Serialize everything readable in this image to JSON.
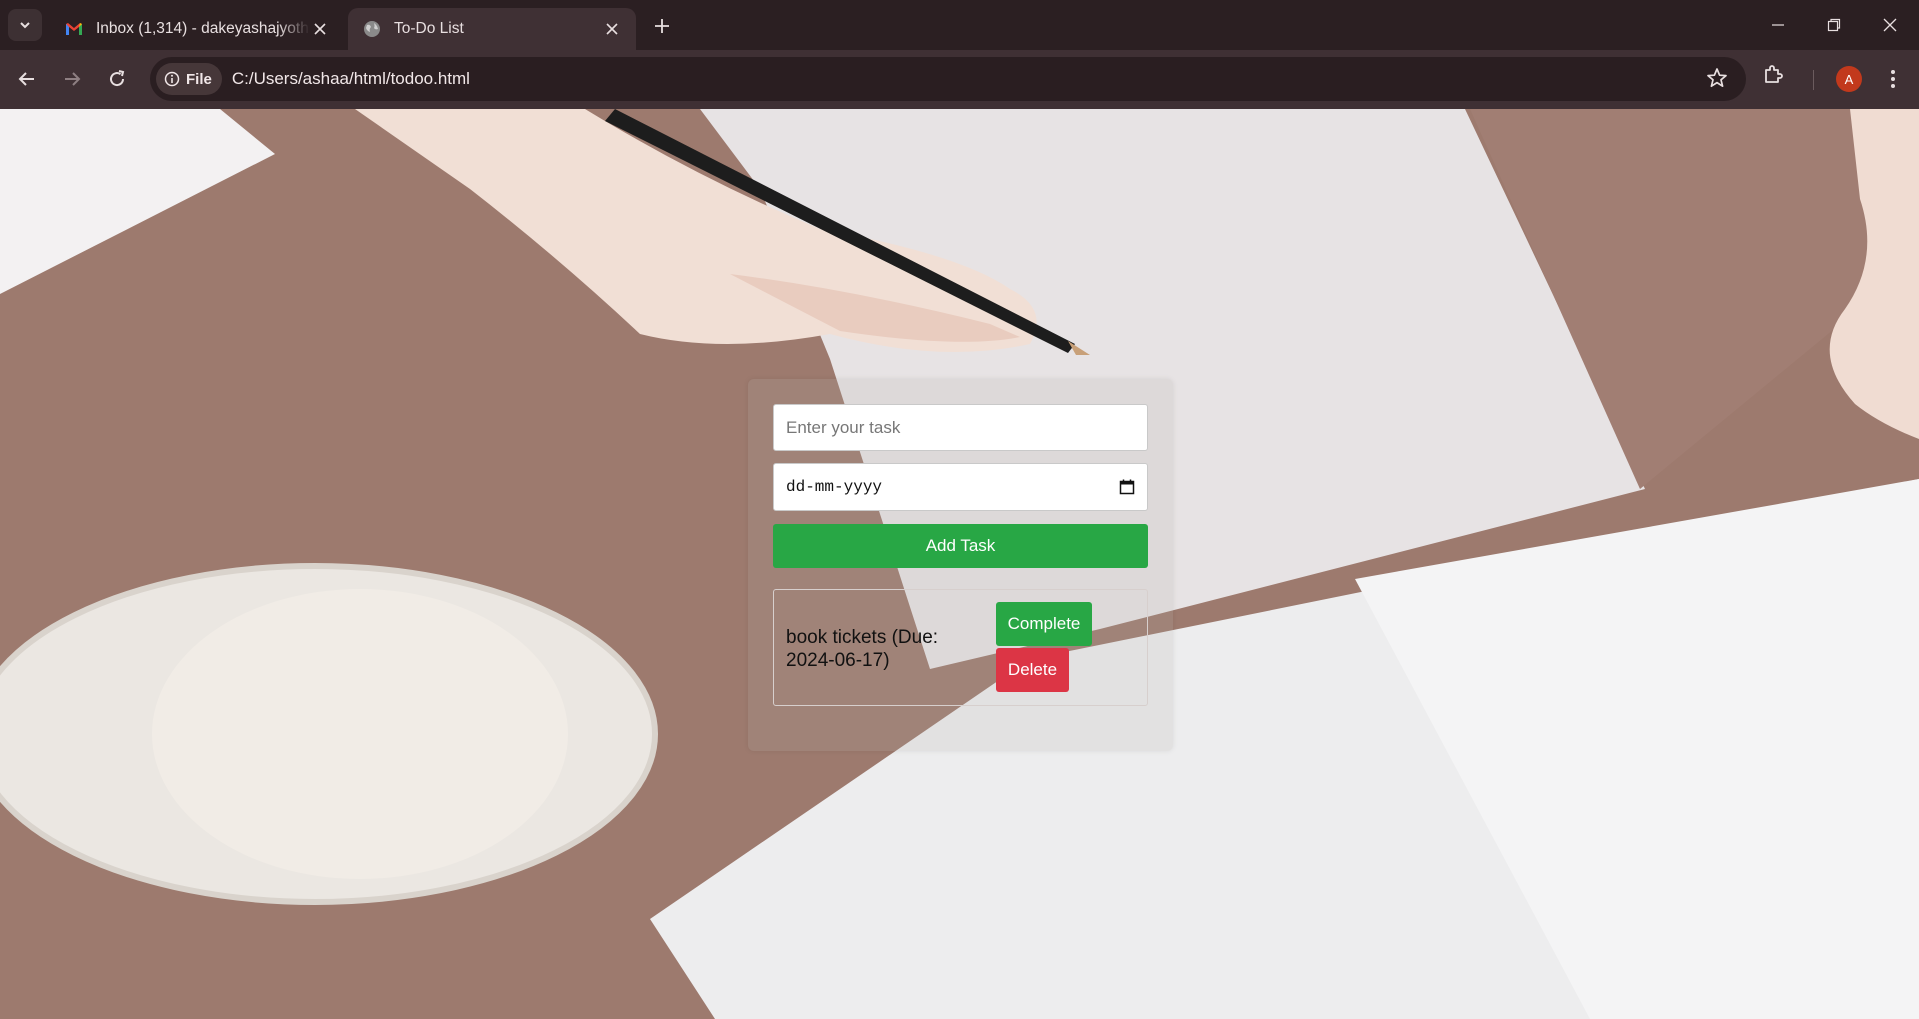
{
  "browser": {
    "tabs": [
      {
        "title": "Inbox (1,314) - dakeyashajyothi...",
        "icon": "gmail-icon",
        "active": false
      },
      {
        "title": "To-Do List",
        "icon": "globe-icon",
        "active": true
      }
    ],
    "address": {
      "scheme_chip": "File",
      "url": "C:/Users/ashaa/html/todoo.html"
    },
    "profile_initial": "A"
  },
  "app": {
    "task_input": {
      "placeholder": "Enter your task",
      "value": ""
    },
    "date_input": {
      "placeholder": "dd-mm-yyyy"
    },
    "add_button": "Add Task",
    "tasks": [
      {
        "text": "book tickets (Due: 2024-06-17)",
        "complete_label": "Complete",
        "delete_label": "Delete"
      }
    ]
  },
  "colors": {
    "add_button": "#28a745",
    "complete_button": "#28a745",
    "delete_button": "#dc3545",
    "avatar": "#c2391c",
    "tabbar": "#2b1f22"
  }
}
